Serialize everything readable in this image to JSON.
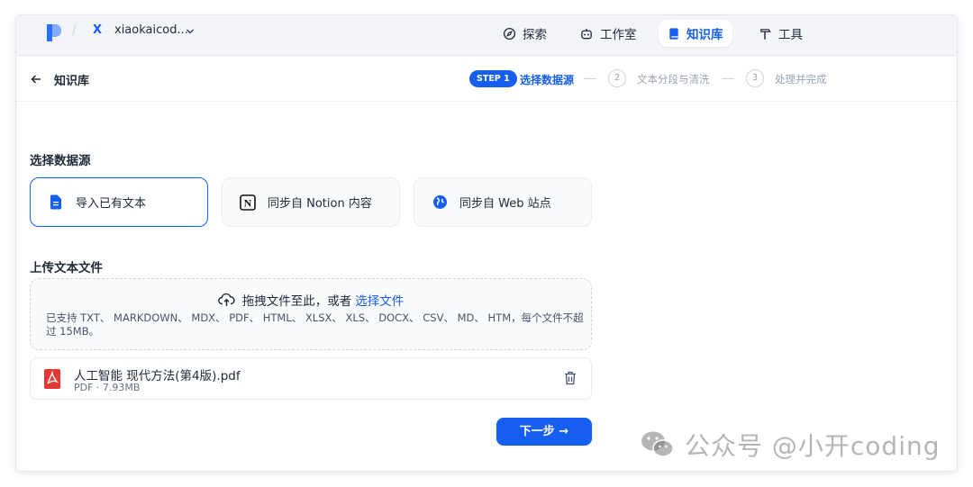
{
  "header": {
    "workspace_initial": "X",
    "workspace_name": "xiaokaicod...",
    "nav": [
      {
        "label": "探索",
        "icon": "compass-icon"
      },
      {
        "label": "工作室",
        "icon": "robot-icon"
      },
      {
        "label": "知识库",
        "icon": "book-icon",
        "active": true
      },
      {
        "label": "工具",
        "icon": "hammer-icon"
      }
    ]
  },
  "subheader": {
    "title": "知识库",
    "steps": [
      {
        "badge": "STEP 1",
        "label": "选择数据源",
        "active": true
      },
      {
        "number": "2",
        "label": "文本分段与清洗"
      },
      {
        "number": "3",
        "label": "处理并完成"
      }
    ]
  },
  "datasource": {
    "section_title": "选择数据源",
    "options": [
      {
        "label": "导入已有文本",
        "icon": "file-icon",
        "selected": true
      },
      {
        "label": "同步自 Notion 内容",
        "icon": "notion-icon"
      },
      {
        "label": "同步自 Web 站点",
        "icon": "globe-icon"
      }
    ]
  },
  "upload": {
    "section_title": "上传文本文件",
    "prompt": "拖拽文件至此，或者",
    "link": "选择文件",
    "description": "已支持 TXT、 MARKDOWN、 MDX、 PDF、 HTML、 XLSX、 XLS、 DOCX、 CSV、 MD、 HTM，每个文件不超过 15MB。"
  },
  "files": [
    {
      "name": "人工智能 现代方法(第4版).pdf",
      "meta": "PDF · 7.93MB"
    }
  ],
  "next_button": "下一步 →",
  "watermark": "公众号 @小开coding",
  "colors": {
    "accent": "#155eef",
    "pdf": "#e53935"
  }
}
